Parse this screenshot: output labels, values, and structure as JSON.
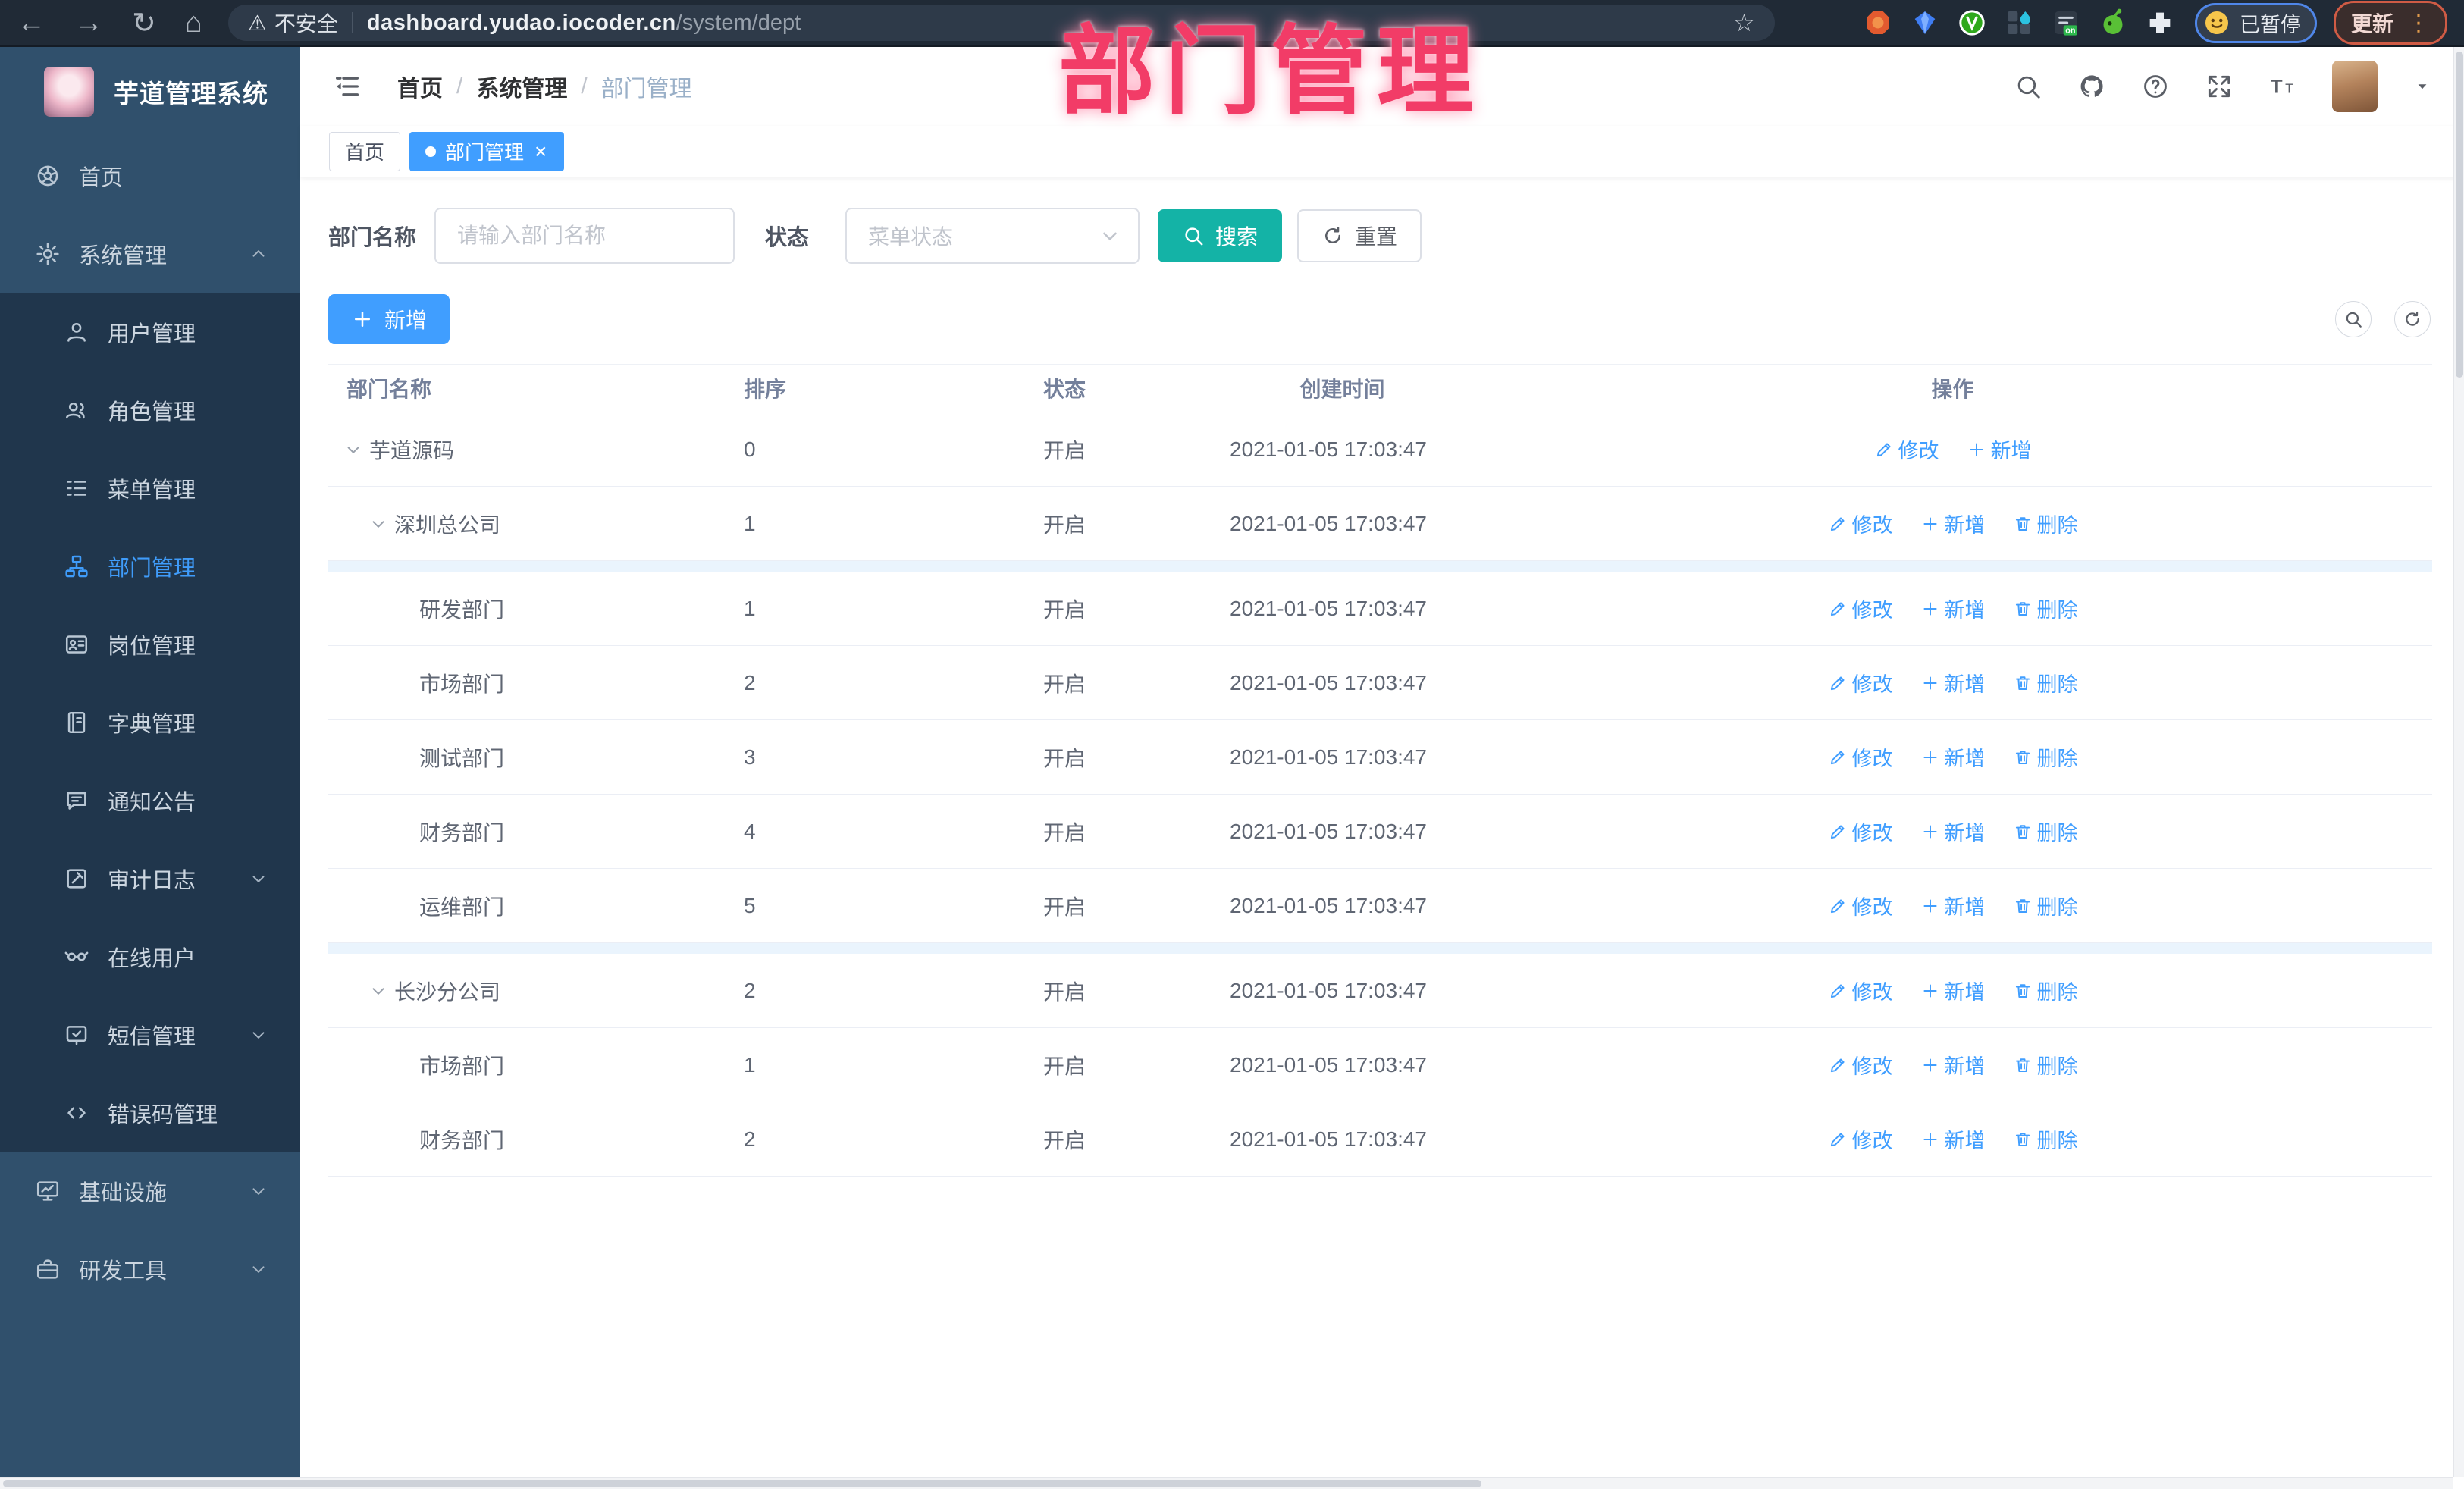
{
  "browser": {
    "insecure_label": "不安全",
    "url_host": "dashboard.yudao.iocoder.cn",
    "url_path": "/system/dept",
    "paused_label": "已暂停",
    "update_label": "更新",
    "icons": {
      "back": "←",
      "forward": "→",
      "reload": "↻",
      "home": "⌂",
      "star": "☆",
      "warning": "⚠",
      "menu_dots": "⋮"
    },
    "extensions": [
      "orange-shield",
      "blue-gem",
      "green-badge",
      "grid-drop",
      "list-on-badge",
      "green-bot",
      "puzzle"
    ]
  },
  "sidebar": {
    "app_title": "芋道管理系统",
    "items": [
      {
        "key": "home",
        "label": "首页",
        "icon": "home-icon"
      },
      {
        "key": "system",
        "label": "系统管理",
        "icon": "gear-icon",
        "chevron": "up"
      },
      {
        "key": "user",
        "label": "用户管理",
        "icon": "user-icon",
        "sub": true
      },
      {
        "key": "role",
        "label": "角色管理",
        "icon": "roles-icon",
        "sub": true
      },
      {
        "key": "menu",
        "label": "菜单管理",
        "icon": "menu-icon",
        "sub": true
      },
      {
        "key": "dept",
        "label": "部门管理",
        "icon": "dept-tree-icon",
        "sub": true,
        "active": true
      },
      {
        "key": "post",
        "label": "岗位管理",
        "icon": "post-icon",
        "sub": true
      },
      {
        "key": "dict",
        "label": "字典管理",
        "icon": "dict-icon",
        "sub": true
      },
      {
        "key": "notice",
        "label": "通知公告",
        "icon": "notice-icon",
        "sub": true
      },
      {
        "key": "audit-log",
        "label": "审计日志",
        "icon": "audit-log-icon",
        "sub": true,
        "chevron": "down"
      },
      {
        "key": "online-user",
        "label": "在线用户",
        "icon": "online-users-icon",
        "sub": true
      },
      {
        "key": "sms",
        "label": "短信管理",
        "icon": "sms-icon",
        "sub": true,
        "chevron": "down"
      },
      {
        "key": "error-code",
        "label": "错误码管理",
        "icon": "error-code-icon",
        "sub": true
      },
      {
        "key": "infra",
        "label": "基础设施",
        "icon": "infra-icon",
        "chevron": "down"
      },
      {
        "key": "dev-tools",
        "label": "研发工具",
        "icon": "dev-tools-icon",
        "chevron": "down"
      }
    ]
  },
  "topbar": {
    "breadcrumb": [
      "首页",
      "系统管理",
      "部门管理"
    ],
    "icons": [
      "search-icon",
      "github-icon",
      "help-icon",
      "fullscreen-icon",
      "font-size-icon"
    ]
  },
  "tabs": [
    {
      "key": "home",
      "label": "首页"
    },
    {
      "key": "dept",
      "label": "部门管理",
      "active": true,
      "close": "×"
    }
  ],
  "filters": {
    "dept_name_label": "部门名称",
    "dept_name_placeholder": "请输入部门名称",
    "status_label": "状态",
    "status_placeholder": "菜单状态",
    "search_label": "搜索",
    "reset_label": "重置"
  },
  "toolbar": {
    "add_label": "新增"
  },
  "table": {
    "headers": [
      "部门名称",
      "排序",
      "状态",
      "创建时间",
      "操作"
    ],
    "action_labels": {
      "edit": "修改",
      "add": "新增",
      "delete": "删除"
    },
    "rows": [
      {
        "name": "芋道源码",
        "level": 0,
        "expandable": true,
        "sort": "0",
        "status": "开启",
        "created": "2021-01-05 17:03:47",
        "actions": [
          "edit",
          "add"
        ]
      },
      {
        "name": "深圳总公司",
        "level": 1,
        "expandable": true,
        "sort": "1",
        "status": "开启",
        "created": "2021-01-05 17:03:47",
        "actions": [
          "edit",
          "add",
          "delete"
        ]
      },
      {
        "name": "研发部门",
        "level": 2,
        "expandable": false,
        "sort": "1",
        "status": "开启",
        "created": "2021-01-05 17:03:47",
        "actions": [
          "edit",
          "add",
          "delete"
        ],
        "stripe_above": true
      },
      {
        "name": "市场部门",
        "level": 2,
        "expandable": false,
        "sort": "2",
        "status": "开启",
        "created": "2021-01-05 17:03:47",
        "actions": [
          "edit",
          "add",
          "delete"
        ]
      },
      {
        "name": "测试部门",
        "level": 2,
        "expandable": false,
        "sort": "3",
        "status": "开启",
        "created": "2021-01-05 17:03:47",
        "actions": [
          "edit",
          "add",
          "delete"
        ]
      },
      {
        "name": "财务部门",
        "level": 2,
        "expandable": false,
        "sort": "4",
        "status": "开启",
        "created": "2021-01-05 17:03:47",
        "actions": [
          "edit",
          "add",
          "delete"
        ]
      },
      {
        "name": "运维部门",
        "level": 2,
        "expandable": false,
        "sort": "5",
        "status": "开启",
        "created": "2021-01-05 17:03:47",
        "actions": [
          "edit",
          "add",
          "delete"
        ]
      },
      {
        "name": "长沙分公司",
        "level": 1,
        "expandable": true,
        "sort": "2",
        "status": "开启",
        "created": "2021-01-05 17:03:47",
        "actions": [
          "edit",
          "add",
          "delete"
        ],
        "stripe_above": true
      },
      {
        "name": "市场部门",
        "level": 2,
        "expandable": false,
        "sort": "1",
        "status": "开启",
        "created": "2021-01-05 17:03:47",
        "actions": [
          "edit",
          "add",
          "delete"
        ]
      },
      {
        "name": "财务部门",
        "level": 2,
        "expandable": false,
        "sort": "2",
        "status": "开启",
        "created": "2021-01-05 17:03:47",
        "actions": [
          "edit",
          "add",
          "delete"
        ]
      }
    ]
  },
  "annotation": {
    "text": "部门管理"
  },
  "colors": {
    "accent": "#409eff",
    "search_button": "#14b3a6",
    "sidebar_bg": "#30506c",
    "submenu_bg": "#20364c",
    "annotation_pink": "#f23c67",
    "browser_bar": "#202a36"
  }
}
